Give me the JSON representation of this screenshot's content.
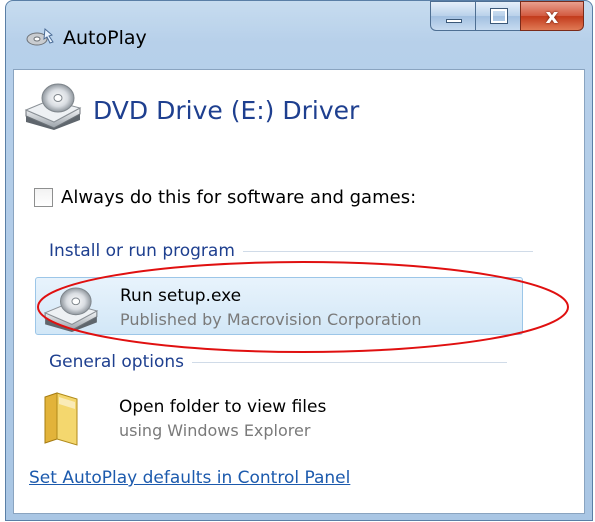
{
  "window": {
    "title": "AutoPlay",
    "controls": {
      "minimize_icon": "minimize-icon",
      "maximize_icon": "maximize-icon",
      "close_glyph": "x"
    }
  },
  "header": {
    "title": "DVD Drive (E:) Driver",
    "icon": "dvd-drive-icon"
  },
  "always_checkbox": {
    "label": "Always do this for software and games:",
    "checked": false
  },
  "groups": {
    "install": {
      "heading": "Install or run program",
      "option": {
        "title": "Run setup.exe",
        "subtitle": "Published by Macrovision Corporation",
        "icon": "dvd-drive-icon"
      }
    },
    "general": {
      "heading": "General options",
      "option": {
        "title": "Open folder to view files",
        "subtitle": "using Windows Explorer",
        "icon": "folder-icon"
      }
    }
  },
  "footer": {
    "link": "Set AutoPlay defaults in Control Panel"
  },
  "colors": {
    "heading_blue": "#1e3f8f",
    "link_blue": "#1c5aad",
    "annotation_red": "#e01010"
  }
}
